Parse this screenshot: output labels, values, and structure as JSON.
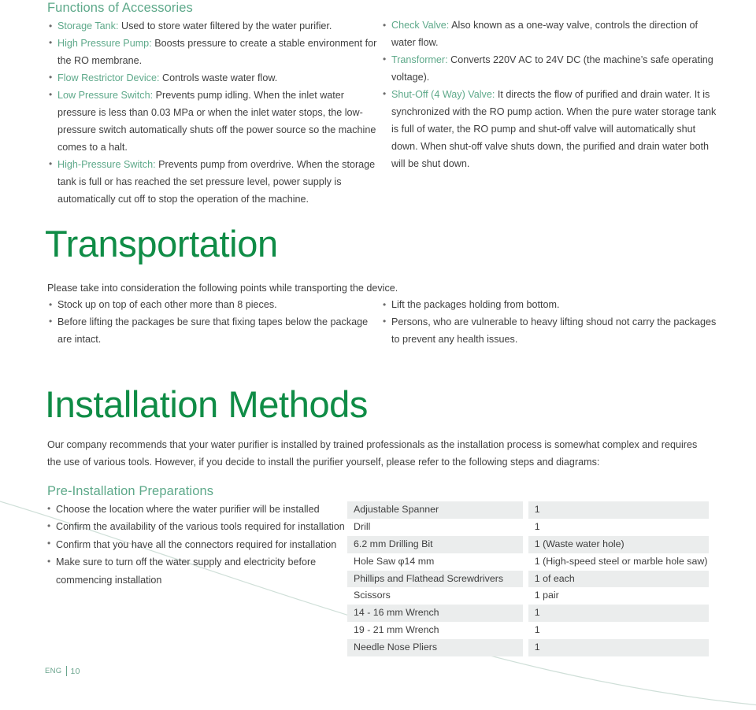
{
  "accessories": {
    "heading": "Functions of Accessories",
    "left_items": [
      {
        "term": "Storage Tank:",
        "text": "Used to store water filtered by the water purifier."
      },
      {
        "term": "High Pressure Pump:",
        "text": "Boosts pressure to create a stable environment for the RO membrane."
      },
      {
        "term": "Flow Restrictor Device:",
        "text": "Controls waste water flow."
      },
      {
        "term": "Low Pressure Switch:",
        "text": "Prevents pump idling. When the inlet water pressure is less than 0.03 MPa or when the inlet water stops, the low-pressure switch automatically shuts off the power source so the machine comes to a halt."
      },
      {
        "term": "High-Pressure Switch:",
        "text": "Prevents pump from overdrive. When the storage tank is full or has reached the set pressure level, power supply is automatically cut off to stop the operation of the machine."
      }
    ],
    "right_items": [
      {
        "term": "Check Valve:",
        "text": "Also known as a one-way valve, controls the direction of water flow."
      },
      {
        "term": "Transformer:",
        "text": "Converts 220V AC to 24V DC (the machine’s safe operating voltage)."
      },
      {
        "term": "Shut-Off (4 Way) Valve:",
        "text": "It directs the flow of purified and drain water. It is synchronized with the RO pump action. When the pure water storage tank is full of water, the RO pump and shut-off valve will automatically shut down. When shut-off valve shuts down, the purified and drain water both will be shut down."
      }
    ]
  },
  "transportation": {
    "heading": "Transportation",
    "intro": "Please take into consideration the following points while transporting the device.",
    "left_items": [
      "Stock up on top of each other more than 8 pieces.",
      "Before lifting the packages be sure that fixing tapes below the package are intact."
    ],
    "right_items": [
      "Lift the packages holding from bottom.",
      "Persons, who are vulnerable to heavy lifting shoud not carry the packages to prevent any health issues."
    ]
  },
  "installation": {
    "heading": "Installation Methods",
    "intro": "Our company recommends that your water purifier is installed by trained professionals as the installation process is somewhat complex and requires the use of various tools. However, if you decide to install the purifier yourself, please refer to the following steps and diagrams:",
    "prep_heading": "Pre-Installation Preparations",
    "prep_items": [
      "Choose the location where the water purifier will be installed",
      "Confirm the availability of the various tools required for installation",
      "Confirm that you have all the connectors required for installation",
      "Make sure to turn off the water supply and electricity before commencing installation"
    ],
    "tools_table": {
      "rows": [
        {
          "name": "Adjustable Spanner",
          "qty": "1"
        },
        {
          "name": "Drill",
          "qty": "1"
        },
        {
          "name": "6.2 mm Drilling Bit",
          "qty": "1 (Waste water hole)"
        },
        {
          "name": "Hole Saw φ14 mm",
          "qty": "1 (High-speed steel or marble hole saw)"
        },
        {
          "name": "Phillips and Flathead Screwdrivers",
          "qty": "1 of each"
        },
        {
          "name": "Scissors",
          "qty": "1 pair"
        },
        {
          "name": "14 - 16 mm Wrench",
          "qty": "1"
        },
        {
          "name": "19 - 21 mm Wrench",
          "qty": "1"
        },
        {
          "name": "Needle Nose Pliers",
          "qty": "1"
        }
      ]
    }
  },
  "footer": {
    "language": "ENG",
    "page_number": "10"
  },
  "colors": {
    "big_heading_green": "#0f8c46",
    "sub_heading_green": "#5ea98a",
    "body_text": "#3f3f3f",
    "table_shade": "#ebeded",
    "decor_curve": "#cfdfd8"
  }
}
